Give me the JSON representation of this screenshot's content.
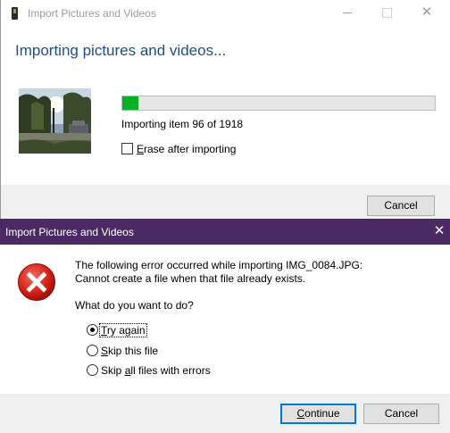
{
  "back_window": {
    "title": "Import Pictures and Videos",
    "heading": "Importing pictures and videos...",
    "progress": {
      "current": 96,
      "total": 1918,
      "fraction": 0.05
    },
    "status_text": "Importing item 96 of 1918",
    "erase_label_prefix": "E",
    "erase_label_rest": "rase after importing",
    "erase_checked": false,
    "cancel_label": "Cancel",
    "progress_color": "#06b025",
    "heading_color": "#1d4f8c"
  },
  "dialog": {
    "title": "Import Pictures and Videos",
    "close_glyph": "✕",
    "message_line1": "The following error occurred while importing IMG_0084.JPG:",
    "message_line2": "Cannot create a file when that file already exists.",
    "question": "What do you want to do?",
    "options": [
      {
        "prefix": "",
        "access": "T",
        "rest": "ry again",
        "selected": true
      },
      {
        "prefix": "",
        "access": "S",
        "rest": "kip this file",
        "selected": false
      },
      {
        "prefix": "Skip ",
        "access": "a",
        "rest": "ll files with errors",
        "selected": false
      }
    ],
    "continue_prefix": "",
    "continue_access": "C",
    "continue_rest": "ontinue",
    "cancel_label": "Cancel",
    "titlebar_color": "#4b2a63",
    "error_icon": "error-icon"
  }
}
